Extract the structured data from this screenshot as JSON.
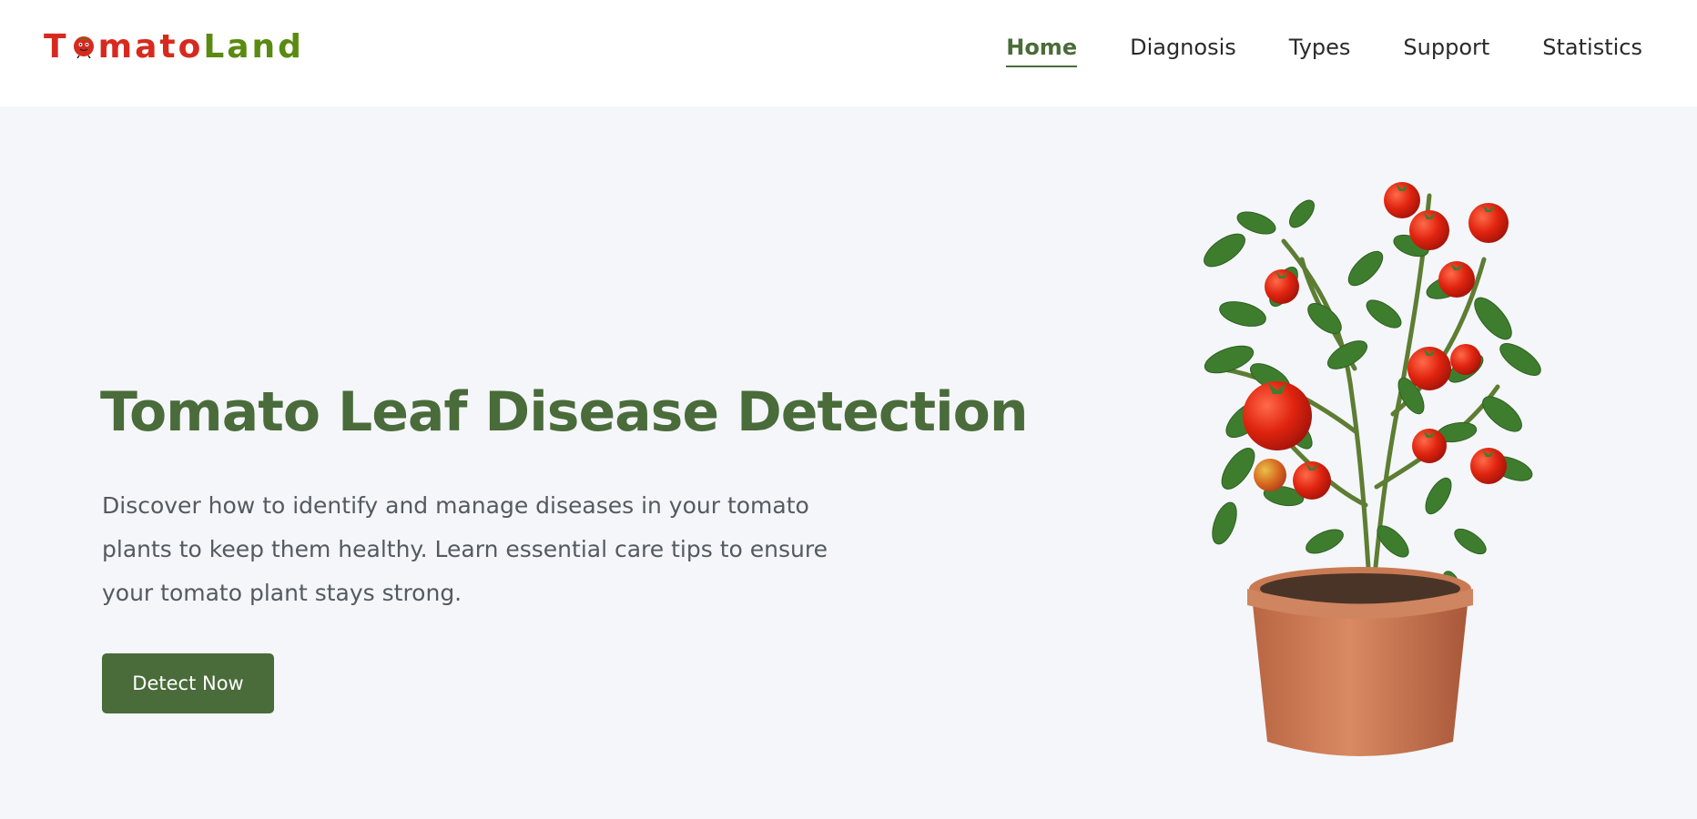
{
  "header": {
    "logo": {
      "part1": "T",
      "part2": "mato",
      "part3": "Land",
      "mascot_icon": "tomato-mascot-icon"
    },
    "nav": [
      {
        "label": "Home",
        "active": true
      },
      {
        "label": "Diagnosis",
        "active": false
      },
      {
        "label": "Types",
        "active": false
      },
      {
        "label": "Support",
        "active": false
      },
      {
        "label": "Statistics",
        "active": false
      }
    ]
  },
  "hero": {
    "title": "Tomato Leaf Disease Detection",
    "description": "Discover how to identify and manage diseases in your tomato plants to keep them healthy. Learn essential care tips to ensure your tomato plant stays strong.",
    "cta_label": "Detect Now",
    "image_icon": "tomato-plant-illustration"
  },
  "colors": {
    "brand_green": "#4a6b3a",
    "logo_red": "#d72a1e",
    "logo_green": "#5b8a12",
    "background": "#f4f6f9"
  }
}
